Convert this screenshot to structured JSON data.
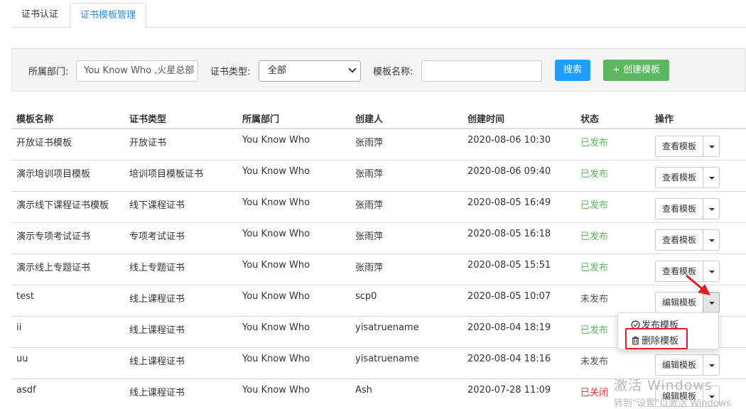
{
  "tabs": [
    {
      "label": "证书认证",
      "active": false
    },
    {
      "label": "证书模板管理",
      "active": true
    }
  ],
  "filters": {
    "department_label": "所属部门:",
    "department_value": "You Know Who ,火星总部",
    "cert_type_label": "证书类型:",
    "cert_type_value": "全部",
    "template_name_label": "模板名称:",
    "template_name_value": "",
    "search_label": "搜索",
    "create_label": "+ 创建模板"
  },
  "table": {
    "headers": [
      "模板名称",
      "证书类型",
      "所属部门",
      "创建人",
      "创建时间",
      "状态",
      "操作"
    ],
    "rows": [
      {
        "name": "开放证书模板",
        "type": "开放证书",
        "dept": "You Know Who",
        "creator": "张雨萍",
        "time": "2020-08-06 10:30",
        "status": "已发布",
        "status_kind": "published",
        "action": "查看模板"
      },
      {
        "name": "演示培训项目模板",
        "type": "培训项目模板证书",
        "dept": "You Know Who",
        "creator": "张雨萍",
        "time": "2020-08-06 09:40",
        "status": "已发布",
        "status_kind": "published",
        "action": "查看模板"
      },
      {
        "name": "演示线下课程证书模板",
        "type": "线下课程证书",
        "dept": "You Know Who",
        "creator": "张雨萍",
        "time": "2020-08-05 16:49",
        "status": "已发布",
        "status_kind": "published",
        "action": "查看模板"
      },
      {
        "name": "演示专项考试证书",
        "type": "专项考试证书",
        "dept": "You Know Who",
        "creator": "张雨萍",
        "time": "2020-08-05 16:18",
        "status": "已发布",
        "status_kind": "published",
        "action": "查看模板"
      },
      {
        "name": "演示线上专题证书",
        "type": "线上专题证书",
        "dept": "You Know Who",
        "creator": "张雨萍",
        "time": "2020-08-05 15:51",
        "status": "已发布",
        "status_kind": "published",
        "action": "查看模板"
      },
      {
        "name": "test",
        "type": "线上课程证书",
        "dept": "You Know Who",
        "creator": "scp0",
        "time": "2020-08-05 10:07",
        "status": "未发布",
        "status_kind": "unpublished",
        "action": "编辑模板"
      },
      {
        "name": "ii",
        "type": "线上课程证书",
        "dept": "You Know Who",
        "creator": "yisatruename",
        "time": "2020-08-04 18:19",
        "status": "已发布",
        "status_kind": "published",
        "action": ""
      },
      {
        "name": "uu",
        "type": "线上课程证书",
        "dept": "You Know Who",
        "creator": "yisatruename",
        "time": "2020-08-04 18:16",
        "status": "未发布",
        "status_kind": "unpublished",
        "action": "编辑模板"
      },
      {
        "name": "asdf",
        "type": "线上课程证书",
        "dept": "You Know Who",
        "creator": "Ash",
        "time": "2020-07-28 11:09",
        "status": "已关闭",
        "status_kind": "closed",
        "action": "编辑模板"
      }
    ]
  },
  "dropdown": {
    "items": [
      {
        "label": "发布模板",
        "icon": "check-circle-icon"
      },
      {
        "label": "删除模板",
        "icon": "trash-icon"
      }
    ]
  },
  "watermark": {
    "line1": "激活 Windows",
    "line2": "转到\"设置\"以激活 Windows"
  },
  "colors": {
    "accent": "#2a8de0",
    "search_button": "#1e9fff",
    "create_button": "#5cb85c",
    "published": "#5cb85c",
    "closed": "#e23b3b",
    "highlight": "#e02020"
  }
}
